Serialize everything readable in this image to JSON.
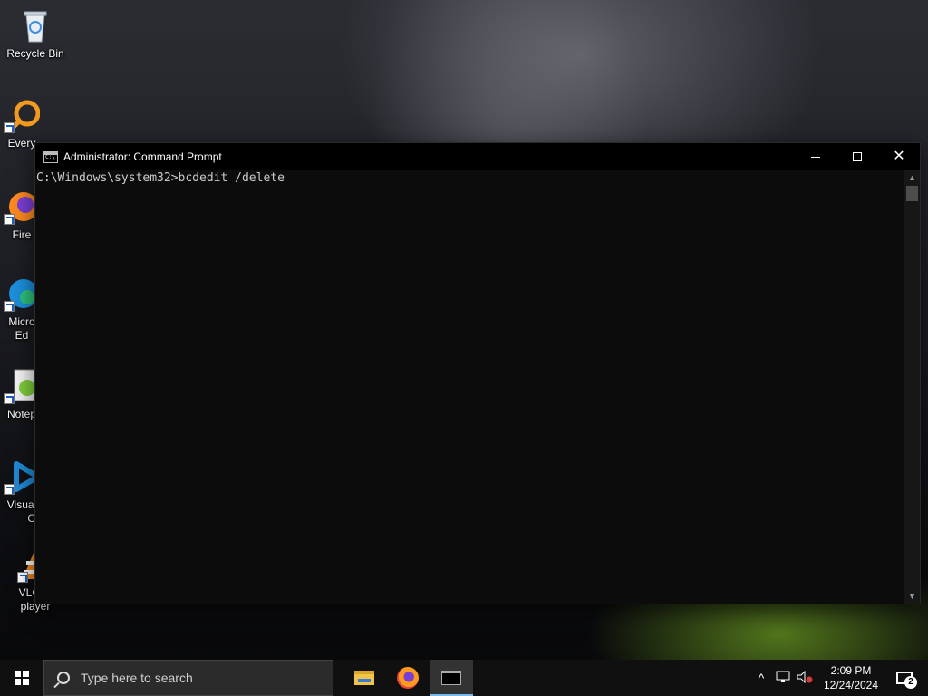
{
  "desktop": {
    "icons": [
      {
        "label": "Recycle Bin",
        "icon": "recycle-bin-icon"
      },
      {
        "label": "Every",
        "icon": "everything-search-icon"
      },
      {
        "label": "Fire",
        "icon": "firefox-icon"
      },
      {
        "label": "Micro",
        "label2": "Ed",
        "icon": "edge-icon"
      },
      {
        "label": "Notep",
        "icon": "notepad-plus-plus-icon"
      },
      {
        "label": "Visual",
        "label2": "Co",
        "icon": "vscode-icon"
      },
      {
        "label": "VLC m",
        "label2": "player",
        "icon": "vlc-icon"
      }
    ]
  },
  "cmd": {
    "title": "Administrator: Command Prompt",
    "line": "C:\\Windows\\system32>bcdedit /delete",
    "minimize_label": "",
    "close_label": "✕",
    "scroll_up": "▲",
    "scroll_down": "▼"
  },
  "taskbar": {
    "search_placeholder": "Type here to search",
    "pinned": [
      "file-explorer-icon",
      "firefox-icon",
      "command-prompt-icon"
    ],
    "tray": {
      "chevron": "^",
      "time": "2:09 PM",
      "date": "12/24/2024",
      "notification_count": "2"
    }
  },
  "colors": {
    "terminal_bg": "#0c0c0c",
    "terminal_text": "#cccccc",
    "taskbar_bg": "#101010",
    "active_indicator": "#76b9ed"
  }
}
